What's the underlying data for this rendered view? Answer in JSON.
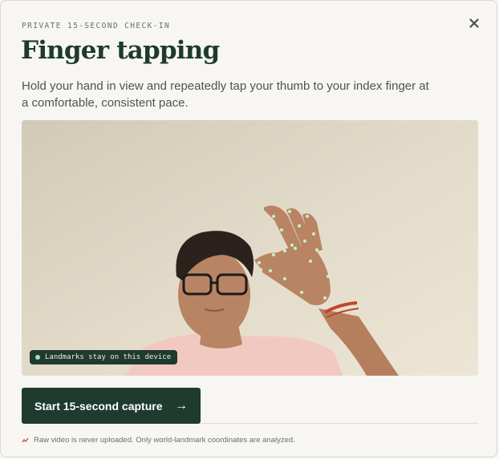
{
  "eyebrow": "PRIVATE 15-SECOND CHECK-IN",
  "close_icon": "×",
  "title": "Finger tapping",
  "description": "Hold your hand in view and repeatedly tap your thumb to your index finger at a comfortable, consistent pace.",
  "camera": {
    "badge_text": "Landmarks stay on this device",
    "landmark_color": "#bff5c9"
  },
  "cta": {
    "label": "Start 15-second capture",
    "arrow": "→"
  },
  "footer": {
    "icon": "camera-off-icon",
    "text": "Raw video is never uploaded. Only world-landmark coordinates are analyzed."
  },
  "colors": {
    "primary": "#1f3a2f",
    "background": "#f7f6f2",
    "accent_red": "#c0574a"
  }
}
